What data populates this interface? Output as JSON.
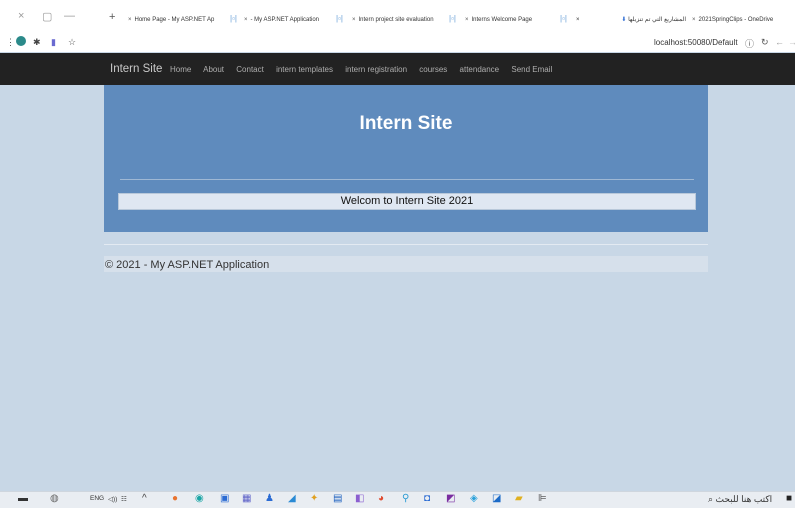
{
  "browser": {
    "window_controls": [
      "×",
      "▢",
      "—"
    ],
    "tabs": [
      {
        "label": "Home Page - My ASP.NET Ap"
      },
      {
        "label": "- My ASP.NET Application"
      },
      {
        "label": "Intern project site evaluation"
      },
      {
        "label": "Interns Welcome Page"
      },
      {
        "label": "المشاريع التي تم تنزيلها"
      },
      {
        "label": "2021SpringClips - OneDrive"
      }
    ],
    "new_tab": "+",
    "url": "localhost:50080/Default"
  },
  "navbar": {
    "brand": "Intern Site",
    "links": [
      "Home",
      "About",
      "Contact",
      "intern templates",
      "intern registration",
      "courses",
      "attendance",
      "Send Email"
    ]
  },
  "jumbotron": {
    "title": "Intern Site",
    "welcome": "Welcom to Intern Site 2021"
  },
  "footer": {
    "text": "© 2021 - My ASP.NET Application"
  },
  "taskbar": {
    "lang": "ENG",
    "search_placeholder": "اكتب هنا للبحث",
    "icons": [
      "firefox-icon",
      "settings-icon",
      "files-icon",
      "teams-icon",
      "people-icon",
      "edge-icon",
      "store-icon",
      "mail-icon",
      "vs-icon",
      "chrome-icon",
      "search-app-icon",
      "camera-icon",
      "onenote-icon",
      "telegram-icon",
      "outlook-icon",
      "explorer-icon",
      "taskview-icon"
    ],
    "colors": {
      "chrome": "#e04a2f",
      "accent": "#2b6bd3"
    }
  }
}
